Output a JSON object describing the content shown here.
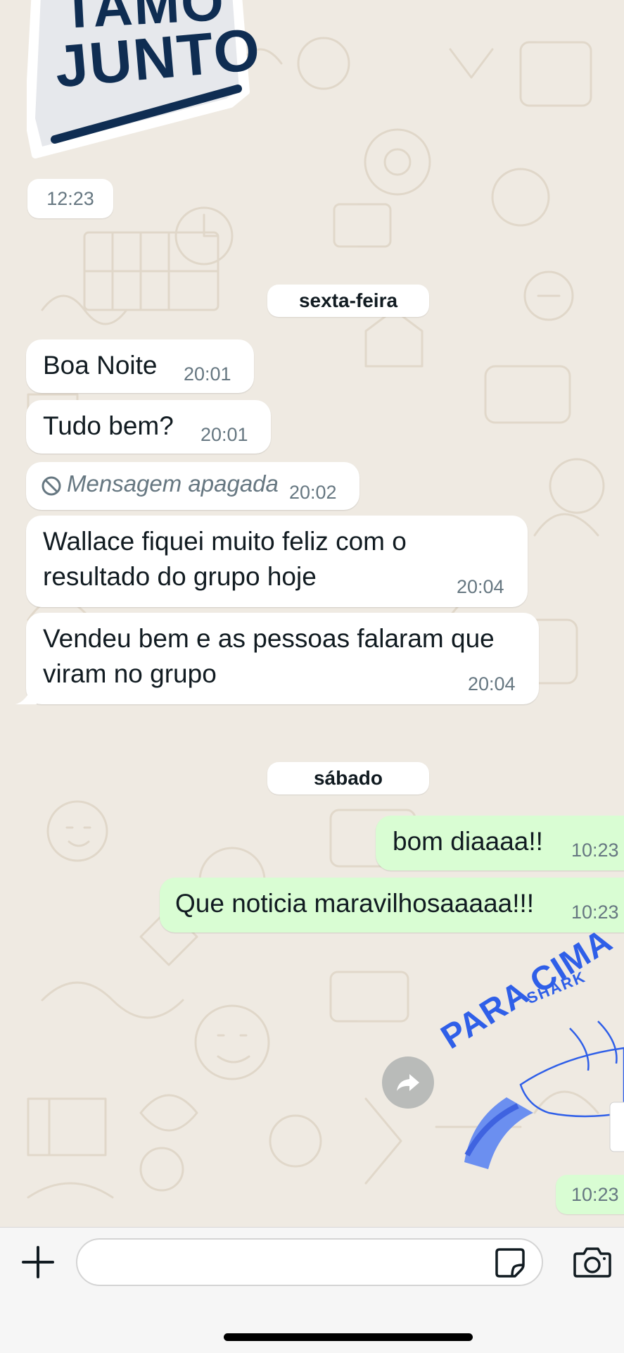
{
  "stickers": {
    "top": {
      "lines": [
        "TAMO",
        "JUNTO"
      ],
      "time": "12:23"
    },
    "bottom": {
      "text": "PARA CIMA",
      "subtext": "SHARK",
      "time": "10:23"
    }
  },
  "day_separators": [
    "sexta-feira",
    "sábado"
  ],
  "messages_friday": [
    {
      "text": "Boa Noite",
      "time": "20:01"
    },
    {
      "text": "Tudo bem?",
      "time": "20:01"
    },
    {
      "text": "Mensagem apagada",
      "time": "20:02",
      "deleted": true
    },
    {
      "lines": [
        "Wallace fiquei muito feliz com o",
        "resultado do grupo hoje"
      ],
      "time": "20:04"
    },
    {
      "lines": [
        "Vendeu bem e as pessoas falaram que",
        "viram no grupo"
      ],
      "time": "20:04"
    }
  ],
  "messages_saturday": [
    {
      "text": "bom diaaaa!!",
      "time": "10:23"
    },
    {
      "text": "Que noticia maravilhosaaaaa!!!",
      "time": "10:23"
    }
  ],
  "icons": {
    "deleted": "ban-icon",
    "forward": "forward-arrow-icon",
    "attach": "plus-icon",
    "sticker": "sticker-icon",
    "camera": "camera-icon"
  },
  "colors": {
    "chat_background": "#efeae2",
    "incoming_bubble": "#ffffff",
    "outgoing_bubble": "#d9fdd3",
    "sticker_navy": "#0f2d52",
    "sticker_blue": "#2f5fe8"
  }
}
